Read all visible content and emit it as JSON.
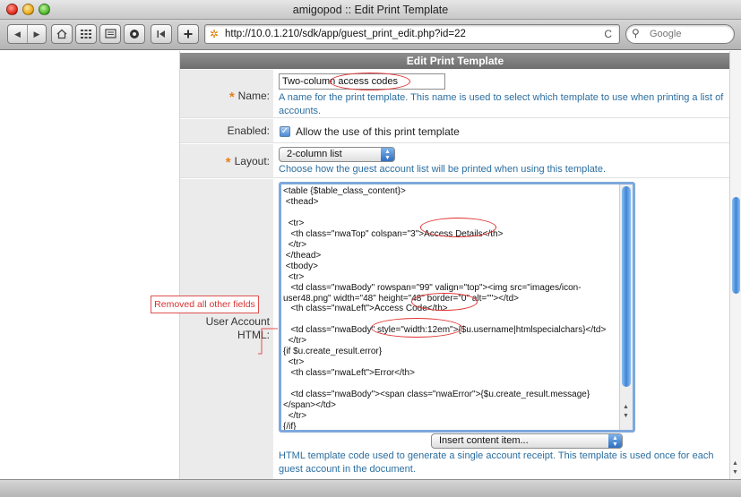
{
  "window": {
    "title": "amigopod :: Edit Print Template"
  },
  "toolbar": {
    "back_icon": "back-arrow-icon",
    "forward_icon": "forward-arrow-icon",
    "home_icon": "home-icon",
    "url": "http://10.0.1.210/sdk/app/guest_print_edit.php?id=22",
    "reload_glyph": "C",
    "search_placeholder": "Google"
  },
  "panel": {
    "header": "Edit Print Template",
    "name": {
      "label": "Name:",
      "value": "Two-column access codes",
      "help": "A name for the print template. This name is used to select which template to use when printing a list of accounts."
    },
    "enabled": {
      "label": "Enabled:",
      "checked": true,
      "check_glyph": "✓",
      "text": "Allow the use of this print template"
    },
    "layout": {
      "label": "Layout:",
      "selected": "2-column list",
      "help": "Choose how the guest account list will be printed when using this template."
    },
    "html": {
      "label": "User Account HTML:",
      "code": "<table {$table_class_content}>\n <thead>\n\n  <tr>\n   <th class=\"nwaTop\" colspan=\"3\">Access Details</th>\n  </tr>\n </thead>\n <tbody>\n  <tr>\n   <td class=\"nwaBody\" rowspan=\"99\" valign=\"top\"><img src=\"images/icon-user48.png\" width=\"48\" height=\"48\" border=\"0\" alt=\"\"></td>\n   <th class=\"nwaLeft\">Access Code</th>\n\n   <td class=\"nwaBody\" style=\"width:12em\">{$u.username|htmlspecialchars}</td>\n  </tr>\n{if $u.create_result.error}\n  <tr>\n   <th class=\"nwaLeft\">Error</th>\n\n   <td class=\"nwaBody\"><span class=\"nwaError\">{$u.create_result.message}</span></td>\n  </tr>\n{/if}",
      "insert_select": "Insert content item...",
      "help": "HTML template code used to generate a single account receipt. This template is used once for each guest account in the document."
    }
  },
  "annotation": {
    "text": "Removed all other fields"
  },
  "colors": {
    "required_asterisk": "#e6801c",
    "help_text": "#2b6ea0",
    "annotation_red": "#e03030",
    "header_gray": "#7a7a7a"
  }
}
